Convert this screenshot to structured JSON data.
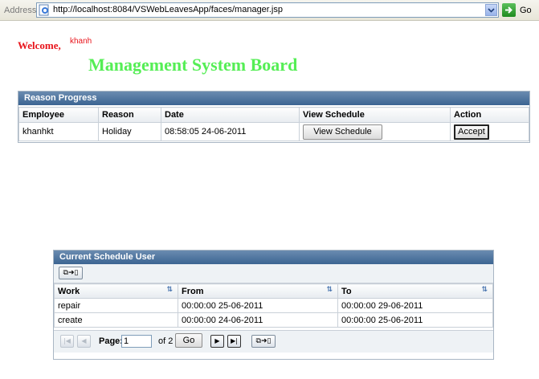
{
  "browser": {
    "address_label": "Address",
    "url": "http://localhost:8084/VSWebLeavesApp/faces/manager.jsp",
    "go_label": "Go"
  },
  "header": {
    "welcome": "Welcome,",
    "username": "khanh",
    "title": "Management System Board"
  },
  "reason_panel": {
    "title": "Reason Progress",
    "columns": [
      "Employee",
      "Reason",
      "Date",
      "View Schedule",
      "Action"
    ],
    "rows": [
      {
        "employee": "khanhkt",
        "reason": "Holiday",
        "date": "08:58:05 24-06-2011",
        "view_label": "View Schedule",
        "action_label": "Accept"
      }
    ]
  },
  "schedule_panel": {
    "title": "Current Schedule User",
    "columns": [
      "Work",
      "From",
      "To"
    ],
    "rows": [
      {
        "work": "repair",
        "from": "00:00:00 25-06-2011",
        "to": "00:00:00 29-06-2011"
      },
      {
        "work": "create",
        "from": "00:00:00 24-06-2011",
        "to": "00:00:00 25-06-2011"
      }
    ],
    "pager": {
      "page_label": "Page:",
      "page_value": "1",
      "of_label": "of 2",
      "go_label": "Go"
    }
  }
}
